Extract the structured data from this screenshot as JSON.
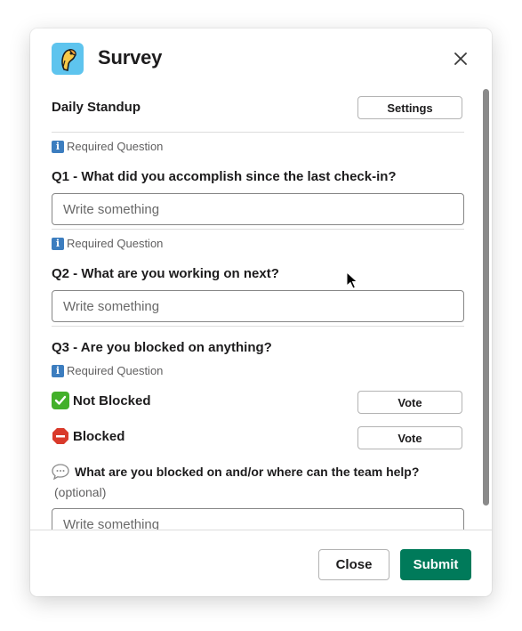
{
  "modal": {
    "title": "Survey",
    "app_icon": "parrot-logo-icon",
    "close_icon": "close-icon"
  },
  "survey": {
    "name": "Daily Standup",
    "settings_label": "Settings"
  },
  "required_label": "Required Question",
  "questions": [
    {
      "label": "Q1 - What did you accomplish since the last check-in?",
      "placeholder": "Write something",
      "value": ""
    },
    {
      "label": "Q2 - What are you working on next?",
      "placeholder": "Write something",
      "value": ""
    }
  ],
  "q3": {
    "label": "Q3 - Are you blocked on anything?",
    "options": [
      {
        "label": "Not Blocked",
        "icon": "green-check-icon",
        "vote_label": "Vote"
      },
      {
        "label": "Blocked",
        "icon": "stop-sign-icon",
        "vote_label": "Vote"
      }
    ],
    "followup_icon": "speech-bubble-icon",
    "followup_label": "What are you blocked on and/or where can the team help?",
    "followup_hint": "(optional)",
    "followup_placeholder": "Write something"
  },
  "footer": {
    "close_label": "Close",
    "submit_label": "Submit"
  },
  "colors": {
    "submit": "#007a5a",
    "app_icon_bg": "#5ec4ee",
    "check": "#43b02a",
    "stop": "#d93a2b"
  }
}
